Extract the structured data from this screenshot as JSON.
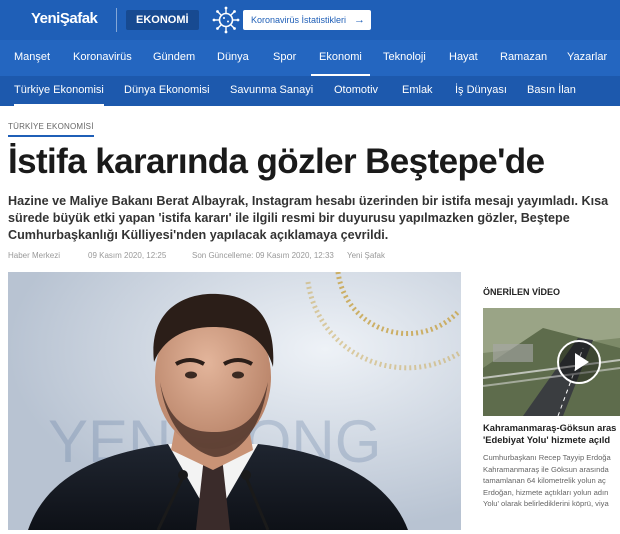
{
  "brand": {
    "logo": "YeniŞafak",
    "section": "EKONOMİ",
    "covid_button": "Koronavirüs İstatistikleri",
    "covid_arrow": "→",
    "colors": {
      "brand_blue": "#1f5fb7",
      "nav_blue": "#2466c0",
      "subnav_blue": "#1d59ad"
    }
  },
  "main_nav": {
    "items": [
      "Manşet",
      "Koronavirüs",
      "Gündem",
      "Dünya",
      "Spor",
      "Ekonomi",
      "Teknoloji",
      "Hayat",
      "Ramazan",
      "Yazarlar"
    ],
    "active": "Ekonomi"
  },
  "sub_nav": {
    "items": [
      "Türkiye Ekonomisi",
      "Dünya Ekonomisi",
      "Savunma Sanayi",
      "Otomotiv",
      "Emlak",
      "İş Dünyası",
      "Basın İlan"
    ],
    "active": "Türkiye Ekonomisi"
  },
  "article": {
    "category": "TÜRKİYE EKONOMİSİ",
    "title": "İstifa kararında gözler Beştepe'de",
    "lead_lines": [
      "Hazine ve Maliye Bakanı Berat Albayrak, Instagram hesabı üzerinden bir istifa mesajı yayımladı. Kısa",
      "sürede büyük etki yapan 'istifa kararı' ile ilgili resmi bir duyurusu yapılmazken gözler, Beştepe",
      "Cumhurbaşkanlığı Külliyesi'nden yapılacak açıklamaya çevrildi."
    ],
    "meta": {
      "source": "Haber Merkezi",
      "published": "09 Kasım 2020, 12:25",
      "updated": "Son Güncelleme: 09 Kasım 2020, 12:33",
      "publisher": "Yeni Şafak"
    },
    "photo_text": "YENİ KONG"
  },
  "sidebar": {
    "heading": "ÖNERİLEN VİDEO",
    "video_title_lines": [
      "Kahramanmaraş-Göksun aras",
      "'Edebiyat Yolu' hizmete açıld"
    ],
    "video_text_lines": [
      "Cumhurbaşkanı Recep Tayyip Erdoğa",
      "Kahramanmaraş ile Göksun arasında",
      "tamamlanan 64 kilometrelik yolun aç",
      "Erdoğan, hizmete açtıkları yolun adın",
      "Yolu' olarak belirlediklerini köprü, viya"
    ]
  }
}
